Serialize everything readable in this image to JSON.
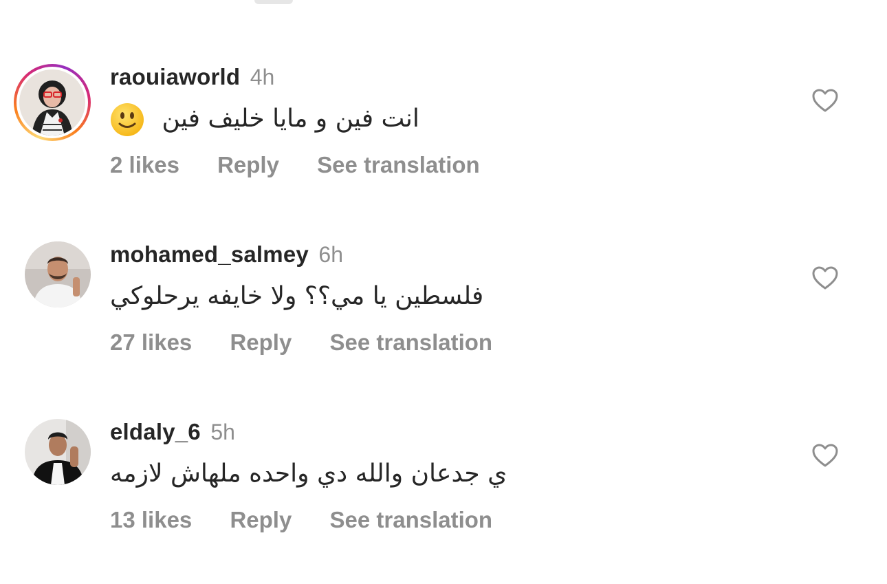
{
  "comments": [
    {
      "username": "raouiaworld",
      "time": "4h",
      "text": "انت فين و مايا خليف فين",
      "emoji": "slightly-smiling-face",
      "likes": "2 likes",
      "reply": "Reply",
      "translate": "See translation",
      "has_story_ring": true
    },
    {
      "username": "mohamed_salmey",
      "time": "6h",
      "text": "فلسطين يا مي؟؟ ولا خايفه يرحلوكي",
      "likes": "27 likes",
      "reply": "Reply",
      "translate": "See translation",
      "has_story_ring": false
    },
    {
      "username": "eldaly_6",
      "time": "5h",
      "text": "ي جدعان والله دي واحده ملهاش لازمه",
      "likes": "13 likes",
      "reply": "Reply",
      "translate": "See translation",
      "has_story_ring": false
    }
  ],
  "icons": {
    "like": "heart-outline-icon"
  },
  "colors": {
    "text_primary": "#262626",
    "text_secondary": "#8e8e8e",
    "story_ring": [
      "#feda75",
      "#fa7e1e",
      "#d62976",
      "#962fbf"
    ]
  }
}
